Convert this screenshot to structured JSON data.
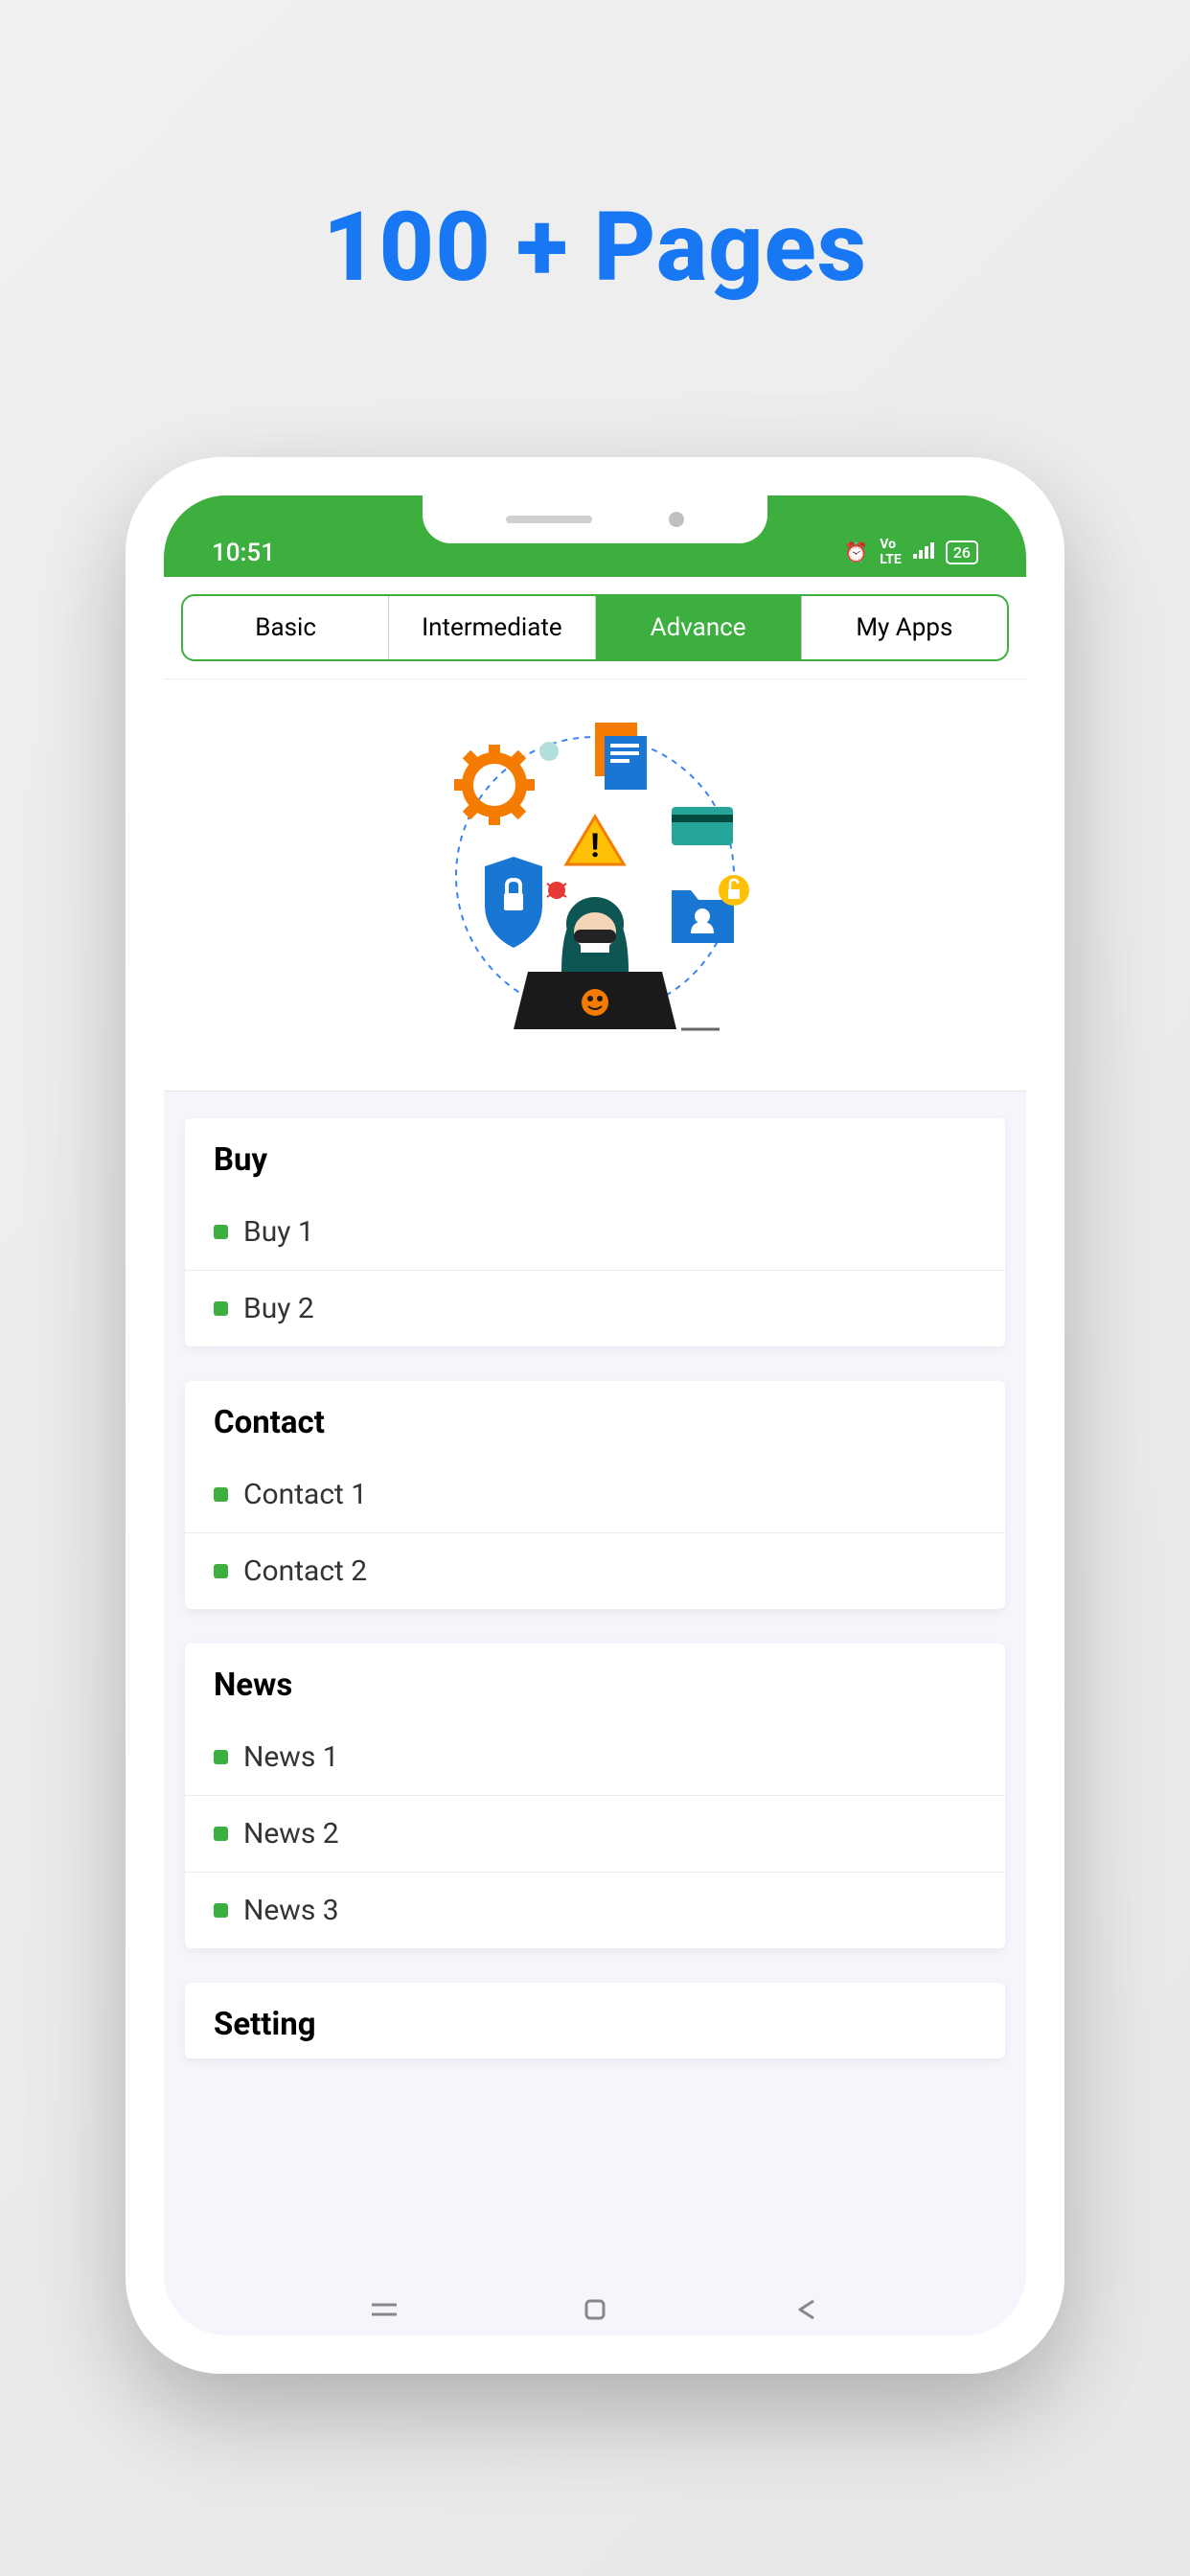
{
  "headline": "100 + Pages",
  "status": {
    "time": "10:51",
    "battery": "26"
  },
  "tabs": [
    {
      "label": "Basic",
      "active": false
    },
    {
      "label": "Intermediate",
      "active": false
    },
    {
      "label": "Advance",
      "active": true
    },
    {
      "label": "My Apps",
      "active": false
    }
  ],
  "sections": [
    {
      "title": "Buy",
      "items": [
        "Buy 1",
        "Buy 2"
      ]
    },
    {
      "title": "Contact",
      "items": [
        "Contact 1",
        "Contact 2"
      ]
    },
    {
      "title": "News",
      "items": [
        "News 1",
        "News 2",
        "News 3"
      ]
    },
    {
      "title": "Setting",
      "items": []
    }
  ]
}
